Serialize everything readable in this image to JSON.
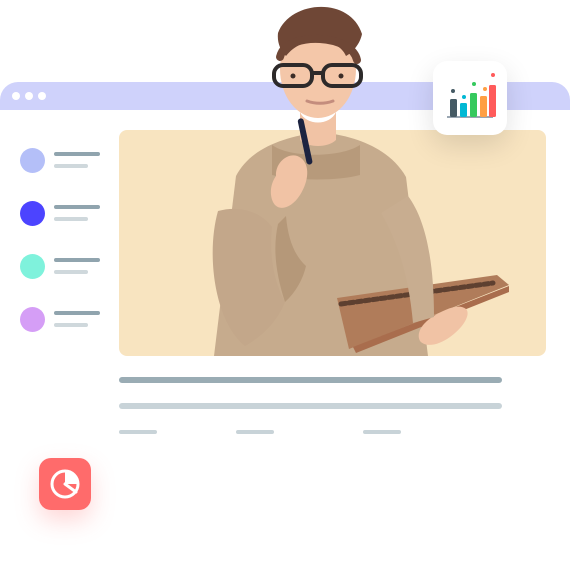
{
  "window": {
    "dots": 3
  },
  "sidebar": {
    "items": [
      {
        "avatar_color": "#b4bff8"
      },
      {
        "avatar_color": "#4c44ff"
      },
      {
        "avatar_color": "#7ff2dc"
      },
      {
        "avatar_color": "#d59ef6"
      }
    ]
  },
  "icons": {
    "chart_card": "bar-chart-icon",
    "pie_card": "pie-chart-icon"
  },
  "colors": {
    "window_bar": "#cfd2fb",
    "hero_panel": "#f8e4c0",
    "pie_card": "#ff6b6b"
  }
}
